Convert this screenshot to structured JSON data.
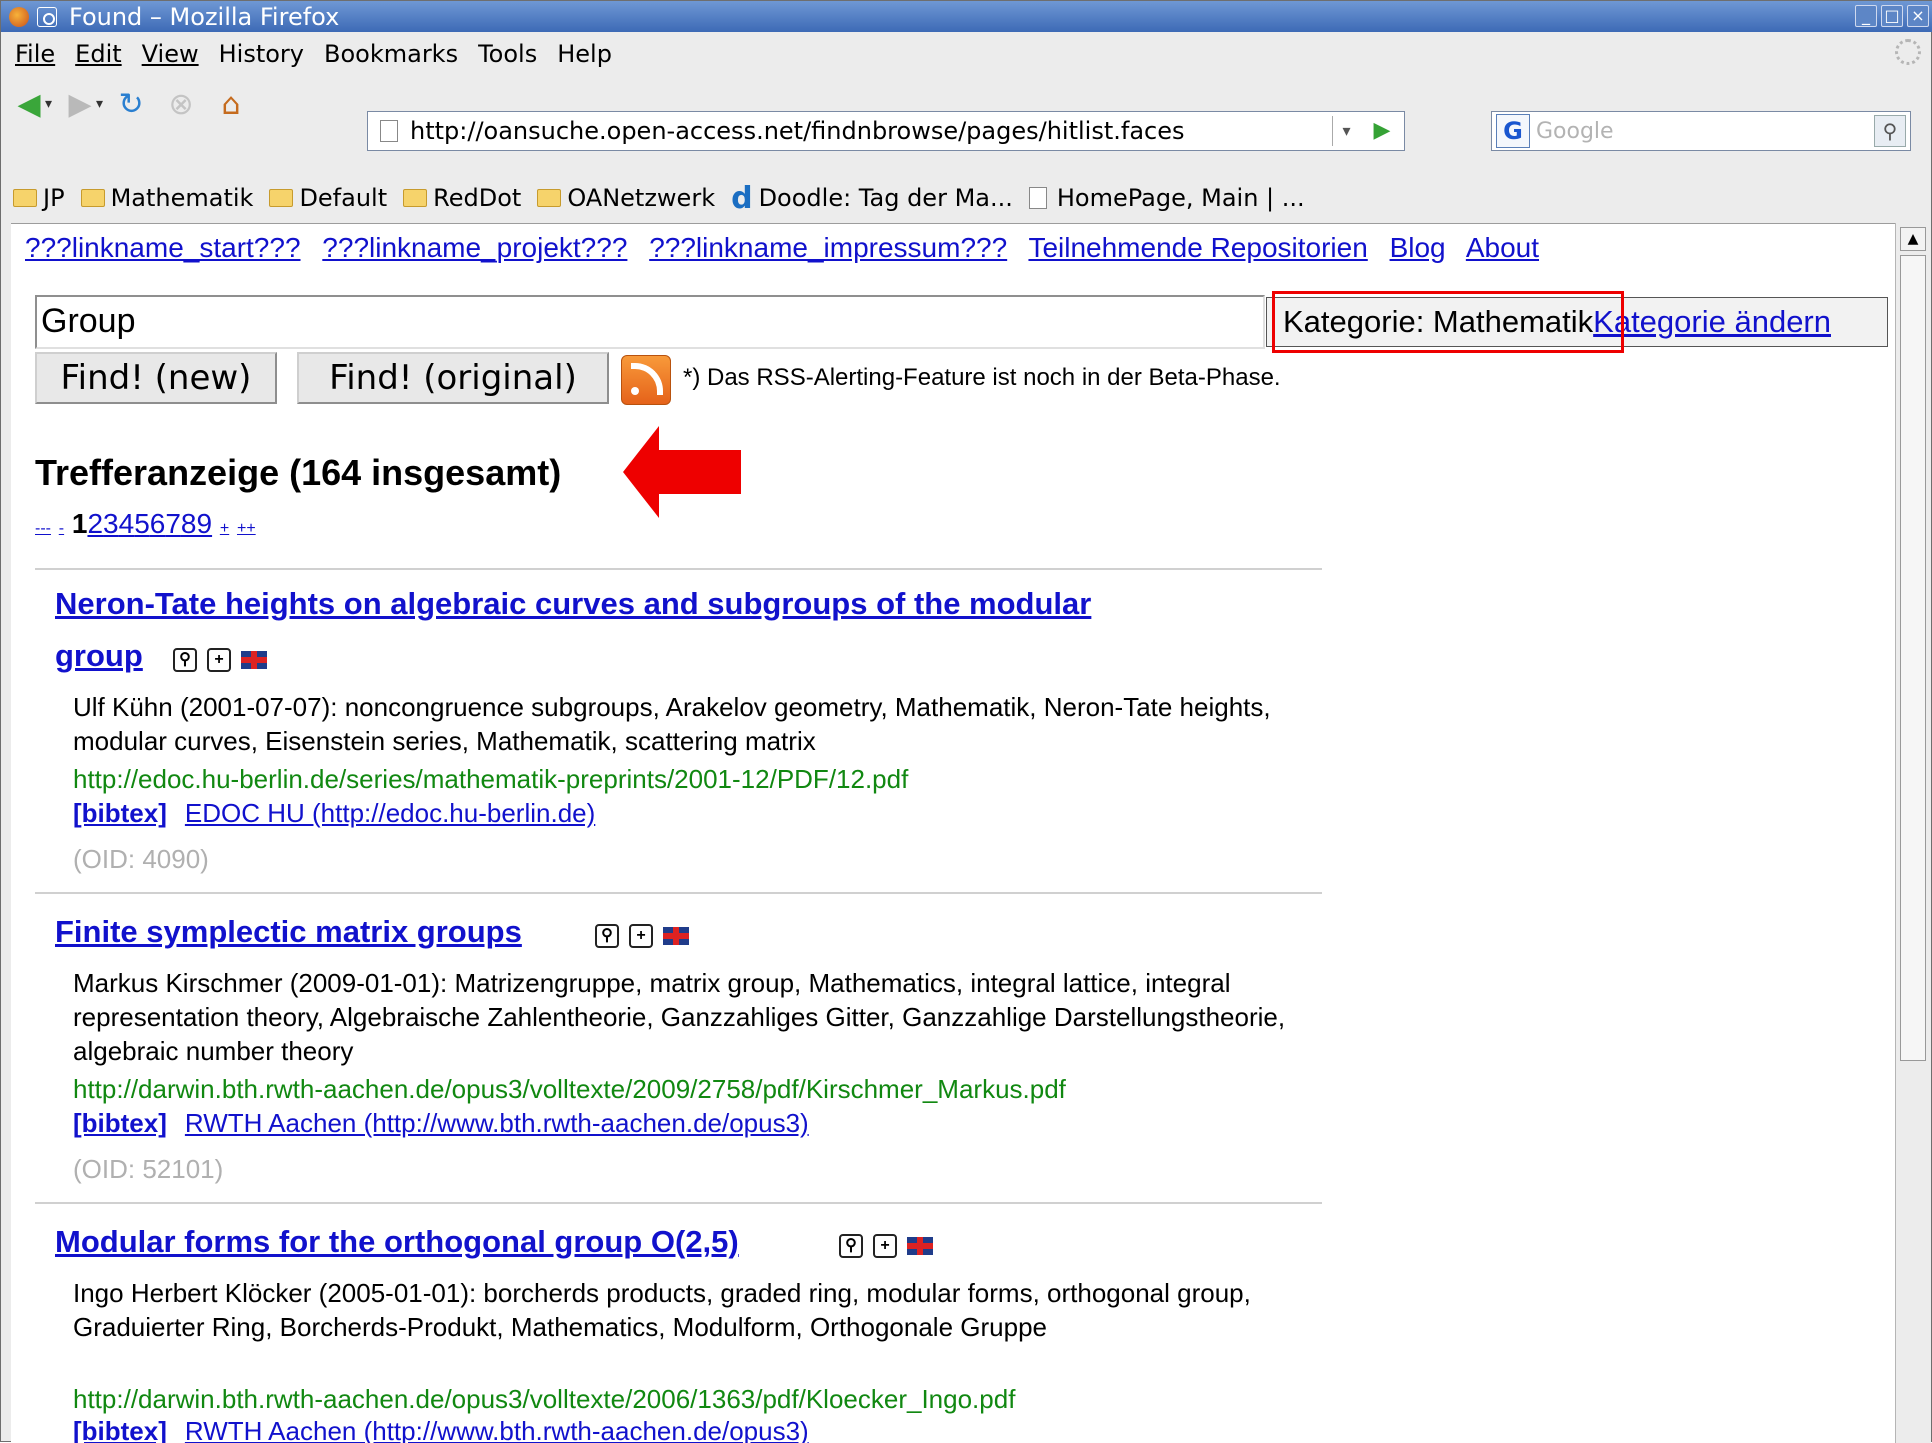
{
  "window": {
    "title": "Found – Mozilla Firefox"
  },
  "menu": [
    {
      "label": "File"
    },
    {
      "label": "Edit"
    },
    {
      "label": "View"
    },
    {
      "label": "History"
    },
    {
      "label": "Bookmarks"
    },
    {
      "label": "Tools"
    },
    {
      "label": "Help"
    }
  ],
  "navigation": {
    "url": "http://oansuche.open-access.net/findnbrowse/pages/hitlist.faces",
    "search_placeholder": "Google"
  },
  "bookmarks": [
    {
      "label": "JP",
      "icon": "folder-icon"
    },
    {
      "label": "Mathematik",
      "icon": "folder-icon"
    },
    {
      "label": "Default",
      "icon": "folder-icon"
    },
    {
      "label": "RedDot",
      "icon": "folder-icon"
    },
    {
      "label": "OANetzwerk",
      "icon": "folder-icon"
    },
    {
      "label": "Doodle: Tag der Ma...",
      "icon": "doodle-icon"
    },
    {
      "label": "HomePage, Main | ...",
      "icon": "page-icon"
    }
  ],
  "page": {
    "top_links": [
      "???linkname_start???",
      "???linkname_projekt???",
      "???linkname_impressum???",
      "Teilnehmende Repositorien",
      "Blog",
      "About"
    ],
    "query": "Group",
    "category_prefix": "Kategorie: Mathematik",
    "category_change": "Kategorie ändern",
    "find_new": "Find! (new)",
    "find_original": "Find! (original)",
    "beta_note": "*) Das RSS-Alerting-Feature ist noch in der Beta-Phase.",
    "heading": "Trefferanzeige (164 insgesamt)",
    "pager": {
      "first": "---",
      "prev": "-",
      "pages": [
        "1",
        "2",
        "3",
        "4",
        "5",
        "6",
        "7",
        "8",
        "9"
      ],
      "current": "1",
      "next": "+",
      "last": "++"
    }
  },
  "results": [
    {
      "title_line1": "Neron-Tate heights on algebraic curves and subgroups of the modular",
      "title_line2": "group",
      "meta": "Ulf Kühn (2001-07-07): noncongruence subgroups, Arakelov geometry, Mathematik, Neron-Tate heights, modular curves, Eisenstein series, Mathematik, scattering matrix",
      "url": "http://edoc.hu-berlin.de/series/mathematik-preprints/2001-12/PDF/12.pdf",
      "bibtex": "[bibtex]",
      "source": "EDOC HU (http://edoc.hu-berlin.de)",
      "oid": "(OID: 4090)"
    },
    {
      "title_line1": "Finite symplectic matrix groups",
      "meta": "Markus Kirschmer (2009-01-01): Matrizengruppe, matrix group, Mathematics, integral lattice, integral representation theory, Algebraische Zahlentheorie, Ganzzahliges Gitter, Ganzzahlige Darstellungstheorie, algebraic number theory",
      "url": "http://darwin.bth.rwth-aachen.de/opus3/volltexte/2009/2758/pdf/Kirschmer_Markus.pdf",
      "bibtex": "[bibtex]",
      "source": "RWTH Aachen (http://www.bth.rwth-aachen.de/opus3)",
      "oid": "(OID: 52101)"
    },
    {
      "title_line1": "Modular forms for the orthogonal group O(2,5)",
      "meta": "Ingo Herbert Klöcker (2005-01-01): borcherds products, graded ring, modular forms, orthogonal group, Graduierter Ring, Borcherds-Produkt, Mathematics, Modulform, Orthogonale Gruppe",
      "url": "http://darwin.bth.rwth-aachen.de/opus3/volltexte/2006/1363/pdf/Kloecker_Ingo.pdf",
      "bibtex": "[bibtex]",
      "source": "RWTH Aachen (http://www.bth.rwth-aachen.de/opus3)"
    }
  ],
  "colors": {
    "annotation_red": "#ee0000",
    "link": "#1111cc",
    "url_green": "#118811"
  }
}
